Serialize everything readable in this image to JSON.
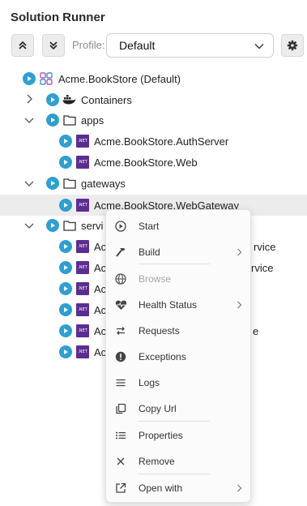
{
  "panel": {
    "title": "Solution Runner"
  },
  "toolbar": {
    "profile_label": "Profile:",
    "profile_value": "Default"
  },
  "tree": [
    {
      "label": "Acme.BookStore (Default)"
    },
    {
      "label": "Containers"
    },
    {
      "label": "apps"
    },
    {
      "label": "Acme.BookStore.AuthServer"
    },
    {
      "label": "Acme.BookStore.Web"
    },
    {
      "label": "gateways"
    },
    {
      "label": "Acme.BookStore.WebGateway"
    },
    {
      "label": "servi"
    },
    {
      "label": "Ac",
      "suffix": "rvice"
    },
    {
      "label": "Ac",
      "suffix": "rvice"
    },
    {
      "label": "Ac"
    },
    {
      "label": "Ac"
    },
    {
      "label": "Ac",
      "suffix": "e"
    },
    {
      "label": "Ac"
    }
  ],
  "net_badge_text": ".NET",
  "menu": {
    "items": [
      {
        "label": "Start",
        "icon": "play-circle-icon"
      },
      {
        "label": "Build",
        "icon": "hammer-icon"
      },
      {
        "label": "Browse",
        "icon": "globe-icon"
      },
      {
        "label": "Health Status",
        "icon": "heart-pulse-icon"
      },
      {
        "label": "Requests",
        "icon": "swap-arrows-icon"
      },
      {
        "label": "Exceptions",
        "icon": "exclamation-circle-icon"
      },
      {
        "label": "Logs",
        "icon": "lines-icon"
      },
      {
        "label": "Copy Url",
        "icon": "copy-icon"
      },
      {
        "label": "Properties",
        "icon": "list-icon"
      },
      {
        "label": "Remove",
        "icon": "x-icon"
      },
      {
        "label": "Open with",
        "icon": "external-link-icon"
      }
    ]
  },
  "colors": {
    "play": "#2e9fd0",
    "net": "#5c2d91",
    "selected_row": "#ececec"
  }
}
